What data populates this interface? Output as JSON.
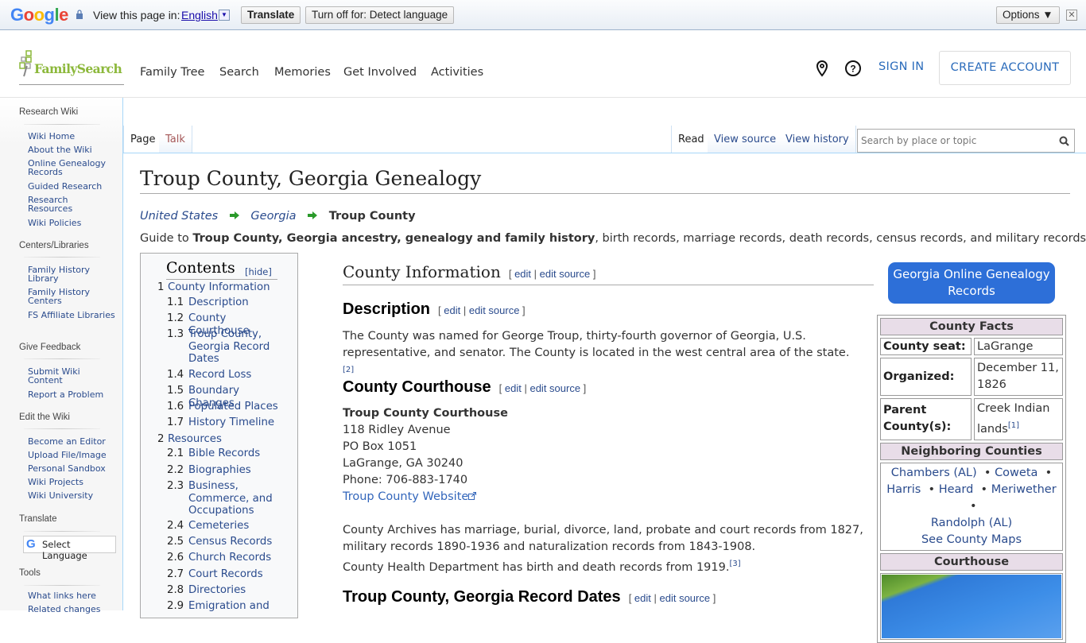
{
  "translate_bar": {
    "brand": "Google",
    "view_in": "View this page in:",
    "language": "English",
    "translate_button": "Translate",
    "turn_off_button": "Turn off for: Detect language",
    "options_button": "Options ▼"
  },
  "header": {
    "logo_text": "FamilySearch",
    "nav": [
      "Family Tree",
      "Search",
      "Memories",
      "Get Involved",
      "Activities"
    ],
    "sign_in": "SIGN IN",
    "create_account": "CREATE ACCOUNT"
  },
  "sidebar": {
    "sections": [
      {
        "title": "Research Wiki",
        "items": [
          "Wiki Home",
          "About the Wiki",
          "Online Genealogy Records",
          "Guided Research",
          "Research Resources",
          "Wiki Policies"
        ]
      },
      {
        "title": "Centers/Libraries",
        "items": [
          "Family History Library",
          "Family History Centers",
          "FS Affiliate Libraries"
        ]
      },
      {
        "title": "Give Feedback",
        "items": [
          "Submit Wiki Content",
          "Report a Problem"
        ]
      },
      {
        "title": "Edit the Wiki",
        "items": [
          "Become an Editor",
          "Upload File/Image",
          "Personal Sandbox",
          "Wiki Projects",
          "Wiki University"
        ]
      },
      {
        "title": "Translate",
        "items": []
      },
      {
        "title": "Tools",
        "items": [
          "What links here",
          "Related changes"
        ]
      }
    ],
    "select_language": "Select Language"
  },
  "tabs": {
    "page": "Page",
    "talk": "Talk",
    "read": "Read",
    "view_source": "View source",
    "view_history": "View history",
    "search_placeholder": "Search by place or topic"
  },
  "page": {
    "title": "Troup County, Georgia Genealogy",
    "breadcrumb": [
      "United States",
      "Georgia",
      "Troup County"
    ],
    "guide_prefix": "Guide to ",
    "guide_bold": "Troup County, Georgia ancestry, genealogy and family history",
    "guide_suffix": ", birth records, marriage records, death records, census records, and military records."
  },
  "toc": {
    "title": "Contents",
    "hide": "[hide]",
    "items": [
      {
        "num": "1",
        "label": "County Information"
      },
      {
        "num": "1.1",
        "label": "Description"
      },
      {
        "num": "1.2",
        "label": "County Courthouse"
      },
      {
        "num": "1.3",
        "label": "Troup County, Georgia Record Dates"
      },
      {
        "num": "1.4",
        "label": "Record Loss"
      },
      {
        "num": "1.5",
        "label": "Boundary Changes"
      },
      {
        "num": "1.6",
        "label": "Populated Places"
      },
      {
        "num": "1.7",
        "label": "History Timeline"
      },
      {
        "num": "2",
        "label": "Resources"
      },
      {
        "num": "2.1",
        "label": "Bible Records"
      },
      {
        "num": "2.2",
        "label": "Biographies"
      },
      {
        "num": "2.3",
        "label": "Business, Commerce, and Occupations"
      },
      {
        "num": "2.4",
        "label": "Cemeteries"
      },
      {
        "num": "2.5",
        "label": "Census Records"
      },
      {
        "num": "2.6",
        "label": "Church Records"
      },
      {
        "num": "2.7",
        "label": "Court Records"
      },
      {
        "num": "2.8",
        "label": "Directories"
      },
      {
        "num": "2.9",
        "label": "Emigration and"
      }
    ]
  },
  "content": {
    "edit": "edit",
    "edit_source": "edit source",
    "county_info_heading": "County Information",
    "description_heading": "Description",
    "description_text": "The County was named for George Troup, thirty-fourth governor of Georgia, U.S. representative, and senator. The County is located in the west central area of the state.",
    "description_ref": "[2]",
    "courthouse_heading": "County Courthouse",
    "courthouse_name": "Troup County Courthouse",
    "address_lines": [
      "118 Ridley Avenue",
      "PO Box 1051",
      "LaGrange, GA 30240",
      "Phone: 706-883-1740"
    ],
    "website_link": "Troup County Website",
    "archives_text_1": "County Archives has marriage, burial, divorce, land, probate and court records from 1827,",
    "archives_text_2": "military records 1890-1936 and naturalization records from 1843-1908.",
    "health_text": "County Health Department has birth and death records from 1919.",
    "health_ref": "[3]",
    "record_dates_heading": "Troup County, Georgia Record Dates"
  },
  "infobox": {
    "online_records_button": "Georgia Online Genealogy Records",
    "facts_header": "County Facts",
    "county_seat_label": "County seat:",
    "county_seat_value": "LaGrange",
    "organized_label": "Organized:",
    "organized_value": "December 11, 1826",
    "parent_label": "Parent County(s):",
    "parent_value": "Creek Indian lands",
    "parent_ref": "[1]",
    "neighbors_header": "Neighboring Counties",
    "neighbors": [
      "Chambers (AL)",
      "Coweta",
      "Harris",
      "Heard",
      "Meriwether",
      "Randolph (AL)"
    ],
    "see_maps": "See County Maps",
    "courthouse_header": "Courthouse"
  }
}
